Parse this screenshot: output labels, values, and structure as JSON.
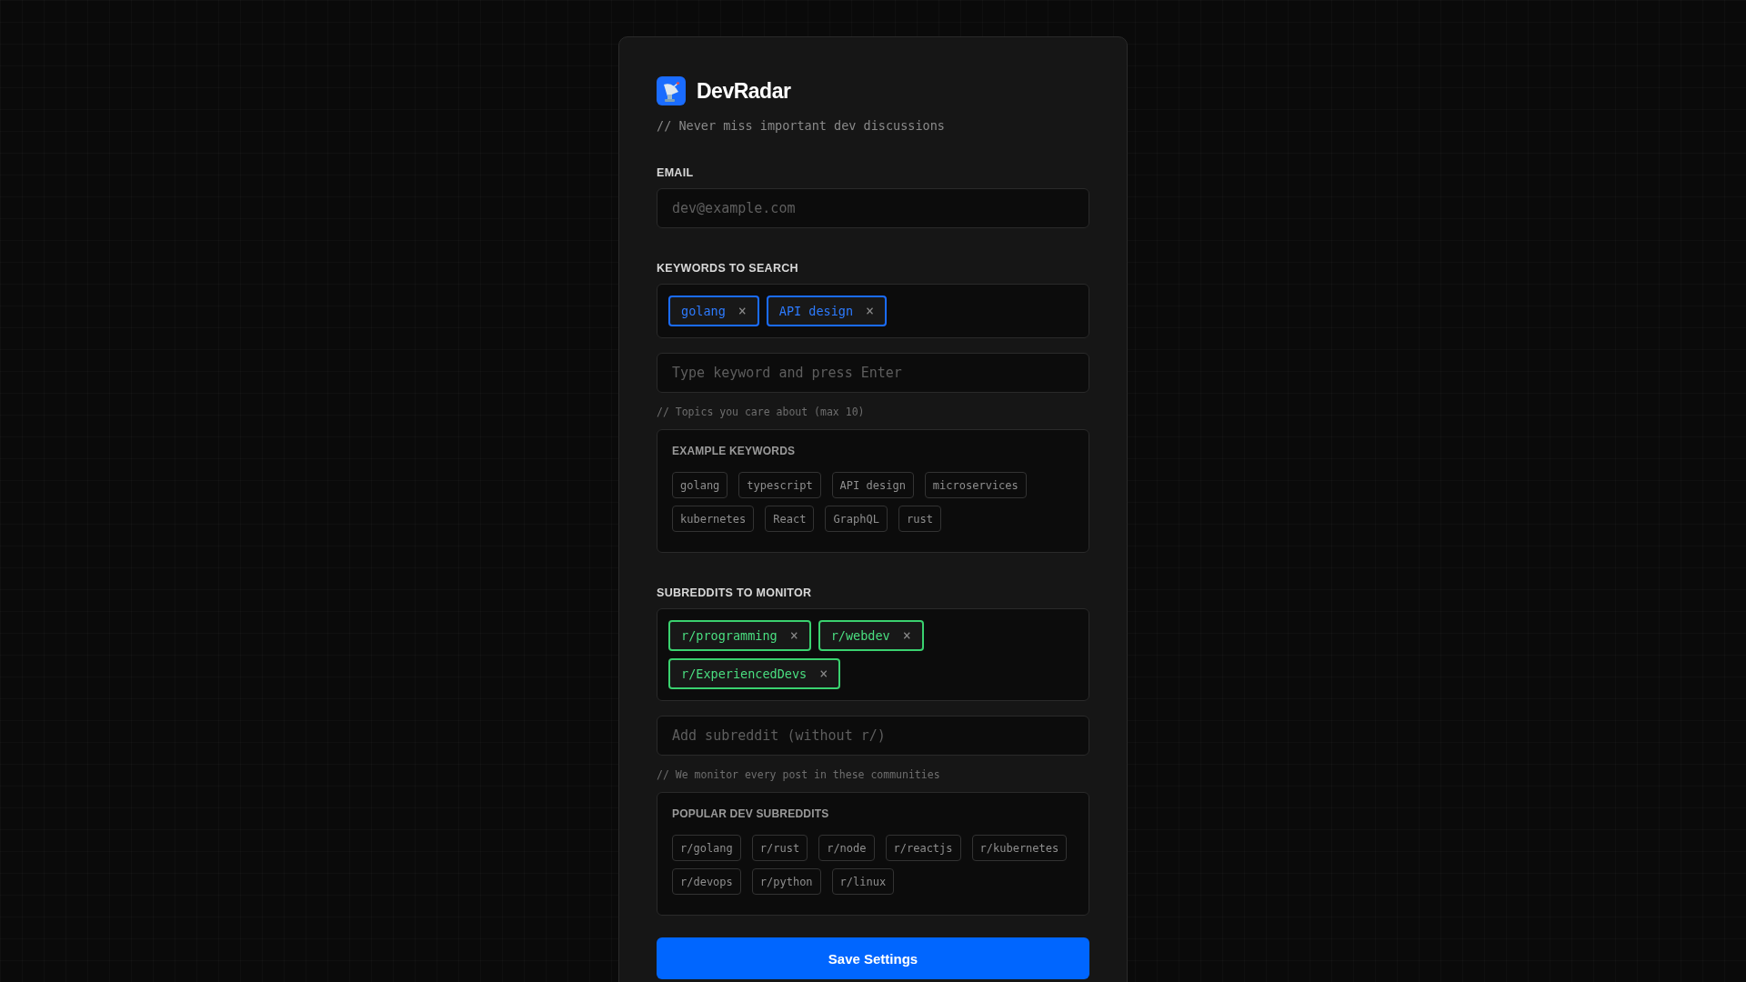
{
  "brand": {
    "name": "DevRadar",
    "tagline": "// Never miss important dev discussions"
  },
  "email": {
    "label": "EMAIL",
    "placeholder": "dev@example.com"
  },
  "keywords": {
    "label": "KEYWORDS TO SEARCH",
    "tags": [
      "golang",
      "API design"
    ],
    "remove_glyph": "×",
    "placeholder": "Type keyword and press Enter",
    "hint": "// Topics you care about (max 10)",
    "examples": {
      "title": "EXAMPLE KEYWORDS",
      "items": [
        "golang",
        "typescript",
        "API design",
        "microservices",
        "kubernetes",
        "React",
        "GraphQL",
        "rust"
      ]
    }
  },
  "subreddits": {
    "label": "SUBREDDITS TO MONITOR",
    "tags": [
      "r/programming",
      "r/webdev",
      "r/ExperiencedDevs"
    ],
    "remove_glyph": "×",
    "placeholder": "Add subreddit (without r/)",
    "hint": "// We monitor every post in these communities",
    "examples": {
      "title": "POPULAR DEV SUBREDDITS",
      "items": [
        "r/golang",
        "r/rust",
        "r/node",
        "r/reactjs",
        "r/kubernetes",
        "r/devops",
        "r/python",
        "r/linux"
      ]
    }
  },
  "save_button": "Save Settings"
}
